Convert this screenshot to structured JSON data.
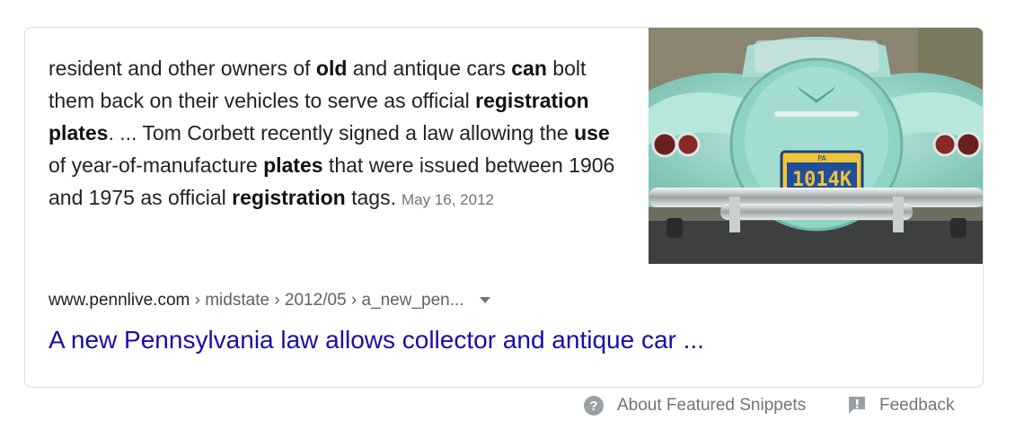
{
  "snippet": {
    "segments": [
      {
        "text": "resident and other owners of ",
        "bold": false
      },
      {
        "text": "old",
        "bold": true
      },
      {
        "text": " and antique cars ",
        "bold": false
      },
      {
        "text": "can",
        "bold": true
      },
      {
        "text": " bolt them back on their vehicles to serve as official ",
        "bold": false
      },
      {
        "text": "registration plates",
        "bold": true
      },
      {
        "text": ". ... Tom Corbett recently signed a law allowing the ",
        "bold": false
      },
      {
        "text": "use",
        "bold": true
      },
      {
        "text": " of year-of-manufacture ",
        "bold": false
      },
      {
        "text": "plates",
        "bold": true
      },
      {
        "text": " that were issued between 1906 and 1975 as official ",
        "bold": false
      },
      {
        "text": "registration",
        "bold": true
      },
      {
        "text": " tags.",
        "bold": false
      }
    ],
    "date": "May 16, 2012"
  },
  "thumbnail": {
    "plate_text": "1014K",
    "plate_state": "PA",
    "body_color": "#9ed8cc"
  },
  "result": {
    "domain": "www.pennlive.com",
    "crumbs": " › midstate › 2012/05 › a_new_pen...",
    "title": "A new Pennsylvania law allows collector and antique car ...",
    "link_color": "#1a0dab"
  },
  "footer": {
    "about_label": "About Featured Snippets",
    "feedback_label": "Feedback"
  }
}
